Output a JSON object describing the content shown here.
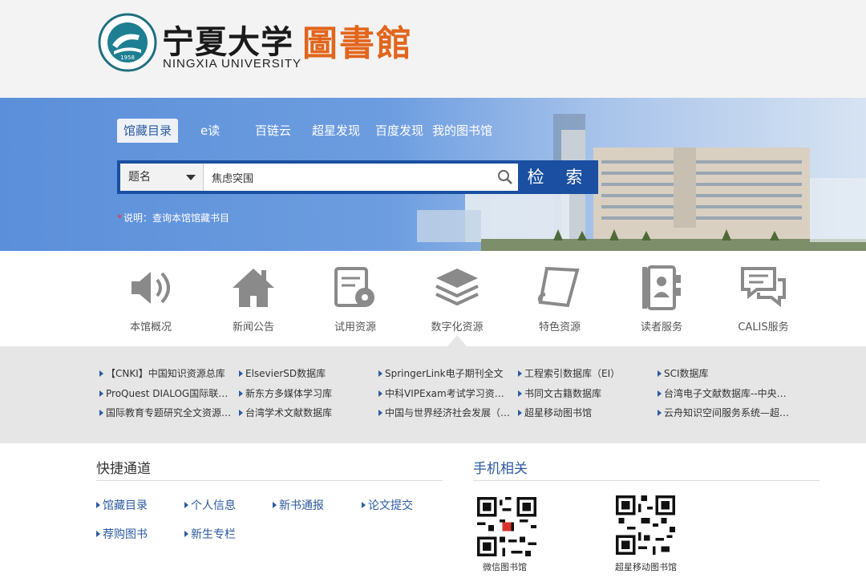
{
  "header": {
    "logo_cn": "宁夏大学",
    "logo_lib": "圖書館",
    "logo_en": "NINGXIA UNIVERSITY",
    "seal_year": "1958"
  },
  "tabs": [
    "馆藏目录",
    "e读",
    "百链云",
    "超星发现",
    "百度发现",
    "我的图书馆"
  ],
  "search": {
    "field": "题名",
    "query": "焦虑突围",
    "button": "检 索"
  },
  "note": "说明：查询本馆馆藏书目",
  "services": [
    "本馆概况",
    "新闻公告",
    "试用资源",
    "数字化资源",
    "特色资源",
    "读者服务",
    "CALIS服务"
  ],
  "databases": [
    [
      "【CNKI】中国知识资源总库",
      "ElsevierSD数据库",
      "SpringerLink电子期刊全文",
      "工程索引数据库（EI）",
      "SCI数据库"
    ],
    [
      "ProQuest DIALOG国际联机检...",
      "新东方多媒体学习库",
      "中科VIPExam考试学习资源数...",
      "书同文古籍数据库",
      "台湾电子文献数据库--中央研..."
    ],
    [
      "国际教育专题研究全文资源库...",
      "台湾学术文献数据库",
      "中国与世界经济社会发展（皮...",
      "超星移动图书馆",
      "云舟知识空间服务系统—超星..."
    ]
  ],
  "quick": {
    "title": "快捷通道",
    "links": [
      "馆藏目录",
      "个人信息",
      "新书通报",
      "论文提交",
      "荐购图书",
      "新生专栏"
    ]
  },
  "mobile": {
    "title": "手机相关",
    "qr_labels": [
      "微信图书馆",
      "超星移动图书馆"
    ]
  },
  "colors": {
    "accent_blue": "#2c5aa0",
    "search_blue": "#1a4fa1",
    "brand_orange": "#e2651d"
  }
}
